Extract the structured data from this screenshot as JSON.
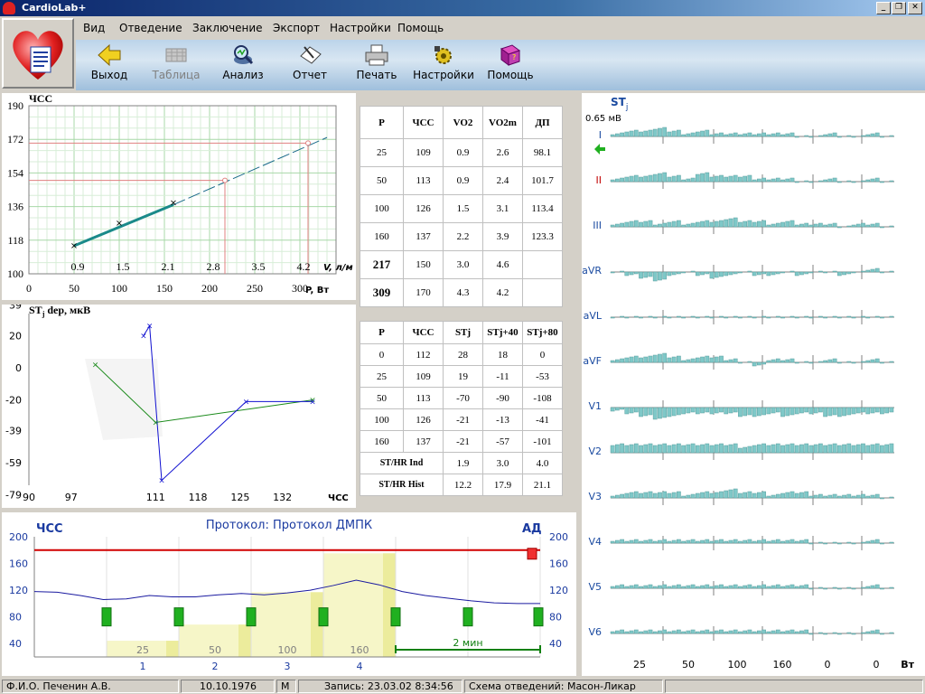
{
  "window": {
    "title": "CardioLab+"
  },
  "menu": [
    "Вид",
    "Отведение",
    "Заключение",
    "Экспорт",
    "Настройки",
    "Помощь"
  ],
  "toolbar": [
    {
      "label": "Выход",
      "icon": "exit-arrow-icon",
      "enabled": true
    },
    {
      "label": "Таблица",
      "icon": "table-icon",
      "enabled": false
    },
    {
      "label": "Анализ",
      "icon": "analysis-icon",
      "enabled": true
    },
    {
      "label": "Отчет",
      "icon": "report-icon",
      "enabled": true
    },
    {
      "label": "Печать",
      "icon": "printer-icon",
      "enabled": true
    },
    {
      "label": "Настройки",
      "icon": "settings-icon",
      "enabled": true
    },
    {
      "label": "Помощь",
      "icon": "help-book-icon",
      "enabled": true
    }
  ],
  "hr_chart": {
    "ylabel": "ЧСС",
    "xlabel": "P, Вт",
    "v_label": "V, л/м",
    "y_ticks": [
      "190",
      "172",
      "154",
      "136",
      "118",
      "100"
    ],
    "x_ticks": [
      "0",
      "50",
      "100",
      "150",
      "200",
      "250",
      "300"
    ],
    "v_ticks": [
      "0.9",
      "1.5",
      "2.1",
      "2.8",
      "3.5",
      "4.2"
    ],
    "points": [
      [
        50,
        115
      ],
      [
        100,
        127
      ],
      [
        160,
        138
      ]
    ],
    "extrapolated": [
      [
        217,
        150
      ],
      [
        309,
        170
      ]
    ]
  },
  "hr_table": {
    "headers": [
      "P",
      "ЧСС",
      "VO2",
      "VO2m",
      "ДП"
    ],
    "rows": [
      [
        "25",
        "109",
        "0.9",
        "2.6",
        "98.1"
      ],
      [
        "50",
        "113",
        "0.9",
        "2.4",
        "101.7"
      ],
      [
        "100",
        "126",
        "1.5",
        "3.1",
        "113.4"
      ],
      [
        "160",
        "137",
        "2.2",
        "3.9",
        "123.3"
      ],
      [
        "217",
        "150",
        "3.0",
        "4.6",
        ""
      ],
      [
        "309",
        "170",
        "4.3",
        "4.2",
        ""
      ]
    ]
  },
  "st_chart": {
    "ylabel_main": "ST",
    "ylabel_sub": "j",
    "ylabel_rest": " dep, мкВ",
    "xlabel": "ЧСС",
    "y_ticks": [
      "39",
      "20",
      "0",
      "-20",
      "-39",
      "-59",
      "-79"
    ],
    "x_ticks": [
      "90",
      "97",
      "111",
      "118",
      "125",
      "132"
    ],
    "series_green": [
      [
        101,
        2
      ],
      [
        111,
        -34
      ],
      [
        137,
        -20
      ]
    ],
    "series_blue": [
      [
        109,
        20
      ],
      [
        110,
        26
      ],
      [
        112,
        -70
      ],
      [
        126,
        -21
      ],
      [
        137,
        -21
      ]
    ]
  },
  "st_table": {
    "headers": [
      "P",
      "ЧСС",
      "STj",
      "STj+40",
      "STj+80"
    ],
    "rows": [
      [
        "0",
        "112",
        "28",
        "18",
        "0"
      ],
      [
        "25",
        "109",
        "19",
        "-11",
        "-53"
      ],
      [
        "50",
        "113",
        "-70",
        "-90",
        "-108"
      ],
      [
        "100",
        "126",
        "-21",
        "-13",
        "-41"
      ],
      [
        "160",
        "137",
        "-21",
        "-57",
        "-101"
      ],
      [
        "ST/HR Ind",
        "",
        "1.9",
        "3.0",
        "4.0"
      ],
      [
        "ST/HR Hist",
        "",
        "12.2",
        "17.9",
        "21.1"
      ]
    ]
  },
  "protocol": {
    "title": "Протокол: Протокол ДМПК",
    "left_label": "ЧСС",
    "right_label": "АД",
    "y_ticks": [
      "200",
      "160",
      "120",
      "80",
      "40"
    ],
    "stage_loads": [
      "25",
      "50",
      "100",
      "160"
    ],
    "stage_numbers": [
      "1",
      "2",
      "3",
      "4"
    ],
    "duration": "2 мин",
    "bp_limit": 180,
    "hr_curve": [
      118,
      117,
      112,
      106,
      107,
      112,
      110,
      110,
      113,
      115,
      113,
      116,
      120,
      127,
      135,
      128,
      118,
      112,
      108,
      104,
      101,
      100,
      100
    ]
  },
  "st_leads": {
    "title": "ST",
    "title_sub": "j",
    "scale": "0.65 мВ",
    "leads": [
      "I",
      "II",
      "III",
      "aVR",
      "aVL",
      "aVF",
      "V1",
      "V2",
      "V3",
      "V4",
      "V5",
      "V6"
    ],
    "lead_colors": [
      "#1a4aa0",
      "#c00000",
      "#1a4aa0",
      "#1a4aa0",
      "#1a4aa0",
      "#1a4aa0",
      "#1a4aa0",
      "#1a4aa0",
      "#1a4aa0",
      "#1a4aa0",
      "#1a4aa0",
      "#1a4aa0"
    ],
    "x_ticks": [
      "25",
      "50",
      "100",
      "160",
      "0",
      "0"
    ],
    "x_unit": "Вт"
  },
  "status": {
    "name": "Ф.И.О. Печенин А.В.",
    "dob": "10.10.1976",
    "sex": "М",
    "record": "Запись: 23.03.02 8:34:56",
    "leads_scheme": "Схема отведений: Масон-Ликар"
  },
  "colors": {
    "accent": "#0a246a",
    "grid": "#c8e6c8",
    "ref_line": "#e08080",
    "series_green": "#1a8a1a",
    "series_blue": "#1010d0",
    "bar": "#7fc8c8",
    "bp_line": "#d00000"
  }
}
